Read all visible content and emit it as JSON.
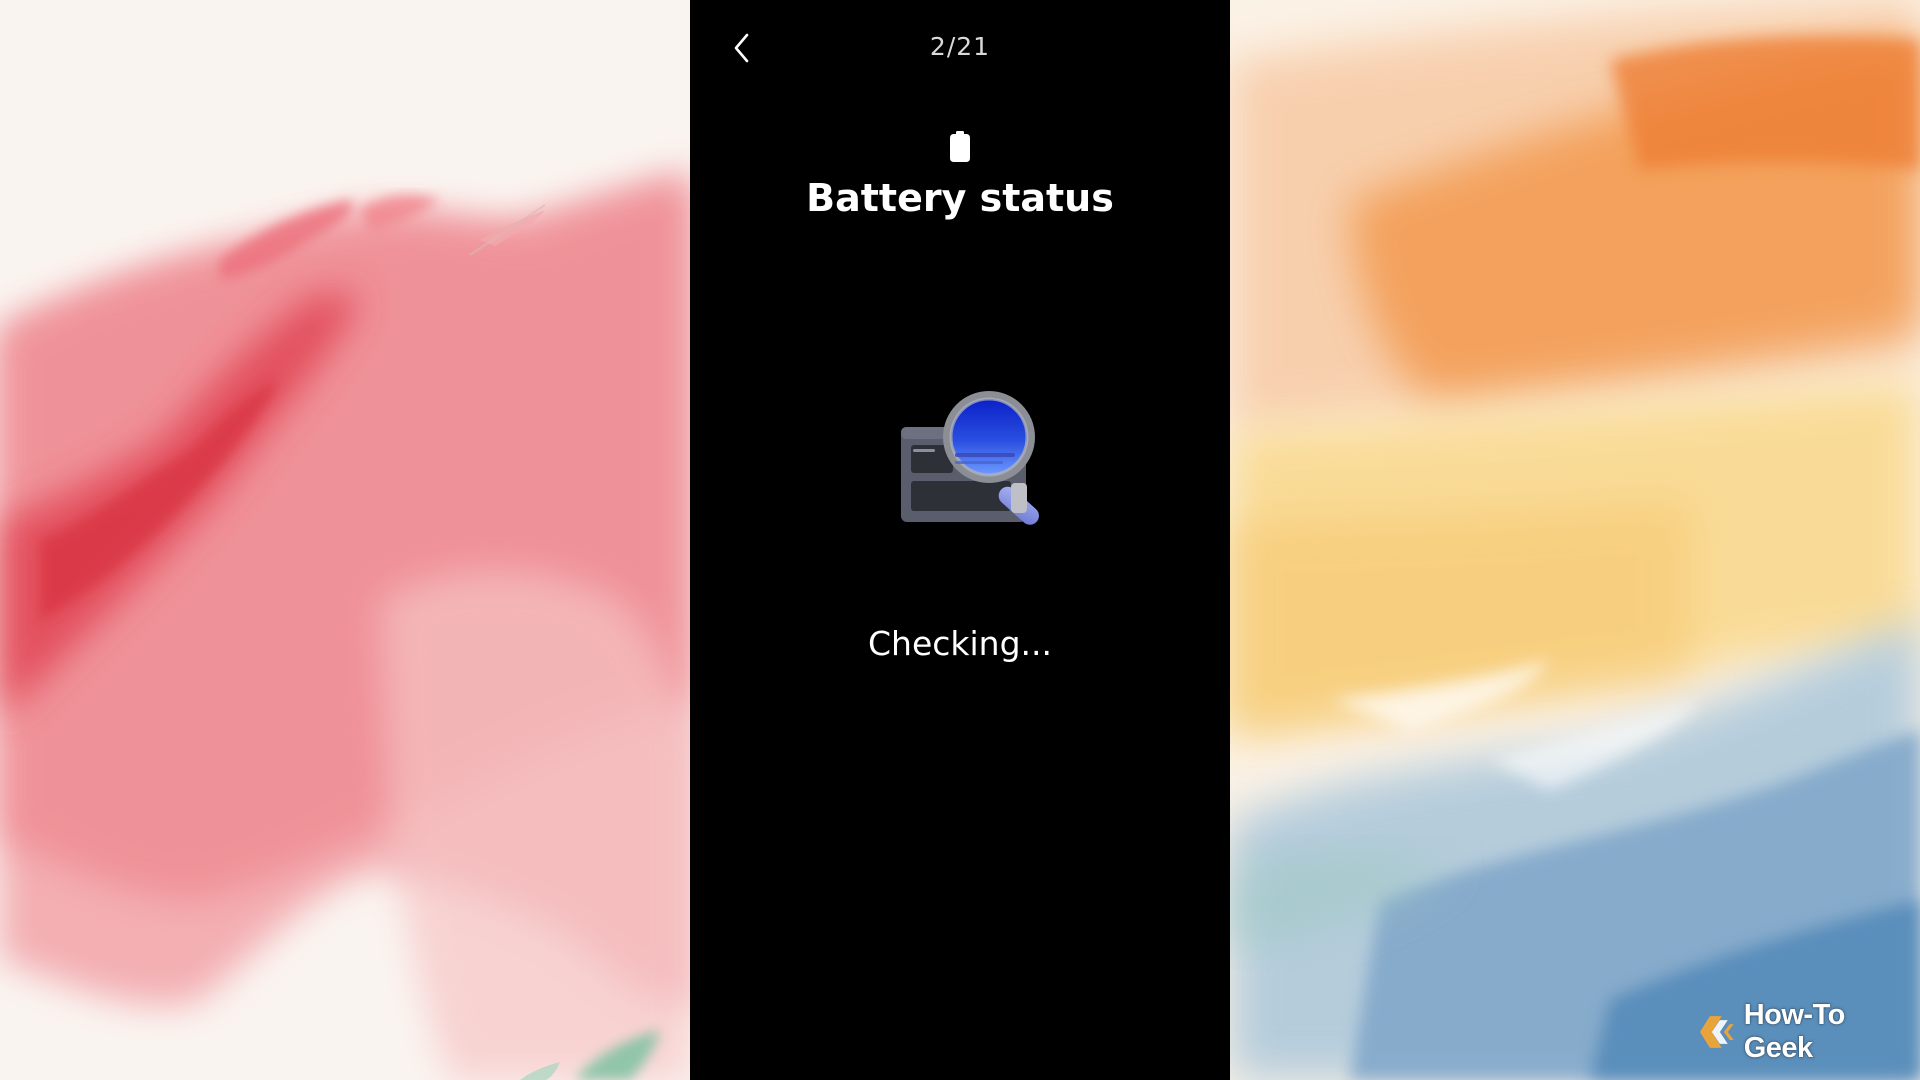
{
  "header": {
    "page_counter": "2/21"
  },
  "main": {
    "title": "Battery status",
    "status_text": "Checking..."
  },
  "icons": {
    "back": "chevron-left-icon",
    "battery": "battery-icon",
    "illustration": "battery-magnifier-illustration"
  },
  "watermark": {
    "text": "How-To Geek"
  },
  "colors": {
    "screen_background": "#000000",
    "text_primary": "#ffffff",
    "magnifier_lens": "#1f3fd6",
    "left_wallpaper_accent": "#e8505f",
    "right_wallpaper_accent": "#f28a3c",
    "right_wallpaper_blue": "#7fa6c9",
    "watermark_logo": "#e8a43b"
  }
}
